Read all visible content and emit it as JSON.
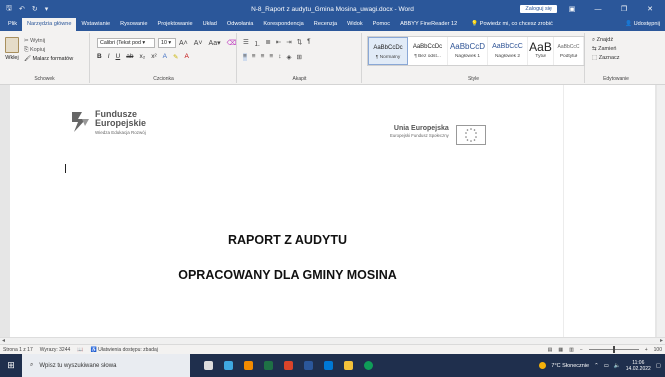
{
  "titlebar": {
    "title": "N-8_Raport z audytu_Gmina Mosina_uwagi.docx  -  Word",
    "signin": "Zaloguj się"
  },
  "tabs": [
    "Plik",
    "Narzędzia główne",
    "Wstawianie",
    "Rysowanie",
    "Projektowanie",
    "Układ",
    "Odwołania",
    "Korespondencja",
    "Recenzja",
    "Widok",
    "Pomoc",
    "ABBYY FineReader 12"
  ],
  "tell_me": "Powiedz mi, co chcesz zrobić",
  "share": "Udostępnij",
  "clipboard": {
    "paste": "Wklej",
    "cut": "Wytnij",
    "copy": "Kopiuj",
    "format_painter": "Malarz formatów",
    "group_label": "Schowek"
  },
  "font": {
    "font_name": "Calibri (Tekst pod",
    "font_size": "10",
    "group_label": "Czcionka"
  },
  "paragraph": {
    "group_label": "Akapit"
  },
  "styles": {
    "items": [
      {
        "sample": "AaBbCcDc",
        "name": "¶ Normalny"
      },
      {
        "sample": "AaBbCcDc",
        "name": "¶ Bez odst..."
      },
      {
        "sample": "AaBbCcD",
        "name": "Nagłówek 1"
      },
      {
        "sample": "AaBbCcC",
        "name": "Nagłówek 2"
      },
      {
        "sample": "AaB",
        "name": "Tytuł"
      },
      {
        "sample": "AaBbCcC",
        "name": "Podtytuł"
      }
    ],
    "group_label": "Style"
  },
  "editing": {
    "find": "Znajdź",
    "replace": "Zamień",
    "select": "Zaznacz",
    "group_label": "Edytowanie"
  },
  "document": {
    "logo_left_line1": "Fundusze",
    "logo_left_line2": "Europejskie",
    "logo_left_line3": "Wiedza Edukacja Rozwój",
    "logo_right_line1": "Unia Europejska",
    "logo_right_line2": "Europejski Fundusz Społeczny",
    "heading1": "RAPORT Z AUDYTU",
    "heading2": "OPRACOWANY DLA GMINY MOSINA"
  },
  "statusbar": {
    "page": "Strona 1 z 17",
    "words": "Wyrazy: 3244",
    "accessibility": "Ułatwienia dostępu: zbadaj",
    "zoom": "100"
  },
  "taskbar": {
    "search_placeholder": "Wpisz tu wyszukiwane słowa",
    "weather": "7°C  Słonecznie",
    "time": "11:06",
    "date": "14.02.2022"
  }
}
